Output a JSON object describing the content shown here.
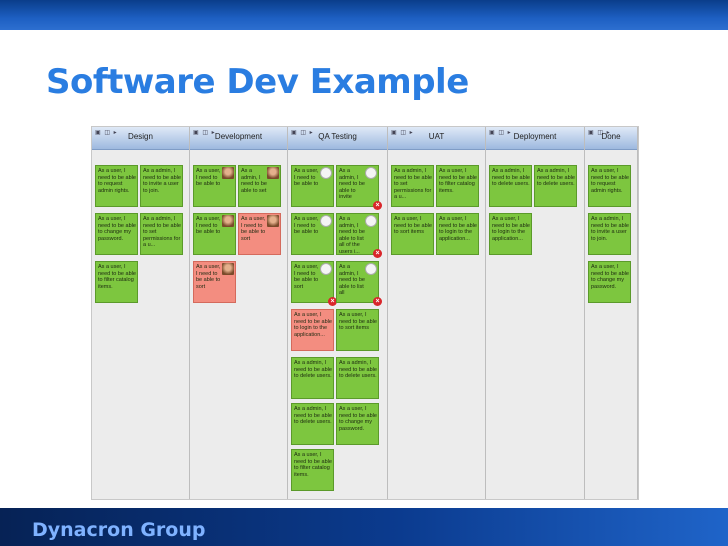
{
  "slide": {
    "title": "Software Dev Example",
    "footer": "Dynacron Group"
  },
  "colors": {
    "title": "#2a7de1",
    "card_green": "#7dc63f",
    "card_red": "#f38d80",
    "footer_bg": "#0b3b8f"
  },
  "board": {
    "column_icons": "▣ ◫ ▸",
    "columns": [
      {
        "title": "Design"
      },
      {
        "title": "Development"
      },
      {
        "title": "QA Testing"
      },
      {
        "title": "UAT"
      },
      {
        "title": "Deployment"
      },
      {
        "title": "Done"
      }
    ],
    "cards": [
      {
        "col": 0,
        "slot": 0,
        "row": 0,
        "color": "green",
        "text": "As a user, I need to be able to request admin rights."
      },
      {
        "col": 0,
        "slot": 1,
        "row": 0,
        "color": "green",
        "text": "As a admin, I need to be able to invite a user to join."
      },
      {
        "col": 0,
        "slot": 0,
        "row": 1,
        "color": "green",
        "text": "As a user, I need to be able to change my password."
      },
      {
        "col": 0,
        "slot": 1,
        "row": 1,
        "color": "green",
        "text": "As a admin, I need to be able to set permissions for a u..."
      },
      {
        "col": 0,
        "slot": 0,
        "row": 2,
        "color": "green",
        "text": "As a user, I need to be able to filter catalog items."
      },
      {
        "col": 1,
        "slot": 0,
        "row": 0,
        "color": "green",
        "text": "As a user, I need to be able to",
        "avatar": "avatar"
      },
      {
        "col": 1,
        "slot": 1,
        "row": 0,
        "color": "green",
        "text": "As a admin, I need to be able to set",
        "avatar": "avatar"
      },
      {
        "col": 1,
        "slot": 0,
        "row": 1,
        "color": "green",
        "text": "As a user, I need to be able to",
        "avatar": "avatar"
      },
      {
        "col": 1,
        "slot": 1,
        "row": 1,
        "color": "red",
        "text": "As a user, I need to be able to sort",
        "avatar": "avatar"
      },
      {
        "col": 1,
        "slot": 0,
        "row": 2,
        "color": "red",
        "text": "As a user, I need to be able to sort",
        "avatar": "avatar"
      },
      {
        "col": 2,
        "slot": 0,
        "row": 0,
        "color": "green",
        "text": "As a user, I need to be able to",
        "avatar": "cat"
      },
      {
        "col": 2,
        "slot": 1,
        "row": 0,
        "color": "green",
        "text": "As a admin, I need to be able to invite",
        "avatar": "cat",
        "blocked": true
      },
      {
        "col": 2,
        "slot": 0,
        "row": 1,
        "color": "green",
        "text": "As a user, I need to be able to",
        "avatar": "cat"
      },
      {
        "col": 2,
        "slot": 1,
        "row": 1,
        "color": "green",
        "text": "As a admin, I need to be able to list all of the users i...",
        "avatar": "cat",
        "blocked": true
      },
      {
        "col": 2,
        "slot": 0,
        "row": 2,
        "color": "green",
        "text": "As a user, I need to be able to sort",
        "avatar": "cat",
        "blocked": true
      },
      {
        "col": 2,
        "slot": 1,
        "row": 2,
        "color": "green",
        "text": "As a admin, I need to be able to list all",
        "avatar": "cat",
        "blocked": true
      },
      {
        "col": 2,
        "slot": 0,
        "row": 3,
        "color": "red",
        "text": "As a user, I need to be able to login to the application..."
      },
      {
        "col": 2,
        "slot": 1,
        "row": 3,
        "color": "green",
        "text": "As a user, I need to be able to sort items"
      },
      {
        "col": 2,
        "slot": 0,
        "row": 4,
        "color": "green",
        "text": "As a admin, I need to be able to delete users."
      },
      {
        "col": 2,
        "slot": 1,
        "row": 4,
        "color": "green",
        "text": "As a admin, I need to be able to delete users."
      },
      {
        "col": 2,
        "slot": 0,
        "row": 5,
        "color": "green",
        "text": "As a admin, I need to be able to delete users."
      },
      {
        "col": 2,
        "slot": 1,
        "row": 5,
        "color": "green",
        "text": "As a user, I need to be able to change my password."
      },
      {
        "col": 2,
        "slot": 0,
        "row": 6,
        "color": "green",
        "text": "As a user, I need to be able to filter catalog items."
      },
      {
        "col": 3,
        "slot": 0,
        "row": 0,
        "color": "green",
        "text": "As a admin, I need to be able to set permissions for a u..."
      },
      {
        "col": 3,
        "slot": 1,
        "row": 0,
        "color": "green",
        "text": "As a user, I need to be able to filter catalog items."
      },
      {
        "col": 3,
        "slot": 0,
        "row": 1,
        "color": "green",
        "text": "As a user, I need to be able to sort items"
      },
      {
        "col": 3,
        "slot": 1,
        "row": 1,
        "color": "green",
        "text": "As a user, I need to be able to login to the application..."
      },
      {
        "col": 4,
        "slot": 0,
        "row": 0,
        "color": "green",
        "text": "As a admin, I need to be able to delete users."
      },
      {
        "col": 4,
        "slot": 1,
        "row": 0,
        "color": "green",
        "text": "As a admin, I need to be able to delete users."
      },
      {
        "col": 4,
        "slot": 0,
        "row": 1,
        "color": "green",
        "text": "As a user, I need to be able to login to the application..."
      },
      {
        "col": 5,
        "slot": 0,
        "row": 0,
        "color": "green",
        "text": "As a user, I need to be able to request admin rights."
      },
      {
        "col": 5,
        "slot": 0,
        "row": 1,
        "color": "green",
        "text": "As a admin, I need to be able to invite a user to join."
      },
      {
        "col": 5,
        "slot": 0,
        "row": 2,
        "color": "green",
        "text": "As a user, I need to be able to change my password."
      }
    ]
  }
}
